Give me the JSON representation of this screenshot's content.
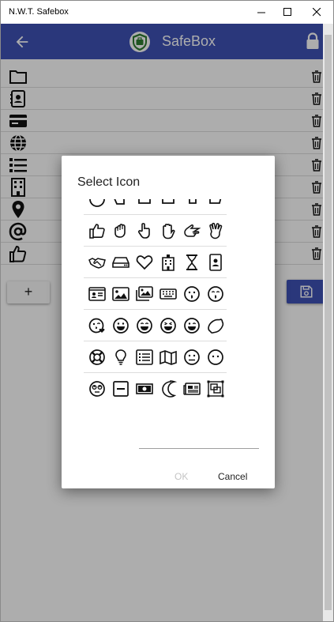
{
  "window": {
    "title": "N.W.T. Safebox"
  },
  "appbar": {
    "title": "SafeBox",
    "color": "#3f51b5"
  },
  "items": [
    {
      "icon": "folder-icon"
    },
    {
      "icon": "contacts-book-icon"
    },
    {
      "icon": "credit-card-icon"
    },
    {
      "icon": "globe-icon"
    },
    {
      "icon": "list-icon"
    },
    {
      "icon": "building-icon"
    },
    {
      "icon": "map-marker-icon"
    },
    {
      "icon": "at-sign-icon"
    },
    {
      "icon": "thumbs-up-icon"
    }
  ],
  "buttons": {
    "add_label": "+"
  },
  "dialog": {
    "title": "Select Icon",
    "ok_label": "OK",
    "cancel_label": "Cancel",
    "input_value": ""
  }
}
